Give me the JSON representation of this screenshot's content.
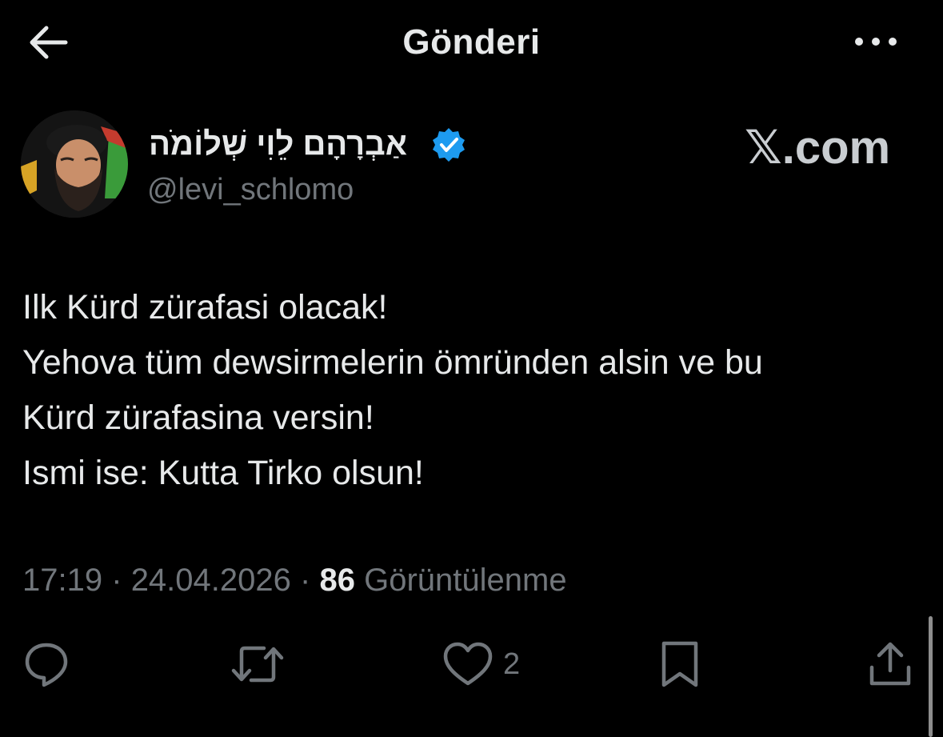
{
  "header": {
    "title": "Gönderi"
  },
  "author": {
    "display_name": "אַבְרָהָם לֵוִי שְׁלוֹמֹה",
    "handle": "@levi_schlomo",
    "verified": true
  },
  "watermark": "𝕏.com",
  "tweet": {
    "lines": [
      "Ilk Kürd zürafasi olacak!",
      "Yehova tüm dewsirmelerin ömründen alsin ve bu",
      "Kürd zürafasina versin!",
      "Ismi ise: Kutta Tirko olsun!"
    ]
  },
  "meta": {
    "time": "17:19",
    "separator": "·",
    "date": "24.04.2026",
    "views_count": "86",
    "views_label": "Görüntülenme"
  },
  "actions": {
    "like_count": "2",
    "icons": [
      "reply-icon",
      "retweet-icon",
      "like-icon",
      "bookmark-icon",
      "share-icon"
    ]
  },
  "colors": {
    "background": "#000000",
    "text": "#e7e9ea",
    "secondary": "#71767b",
    "verified": "#1d9bf0"
  }
}
